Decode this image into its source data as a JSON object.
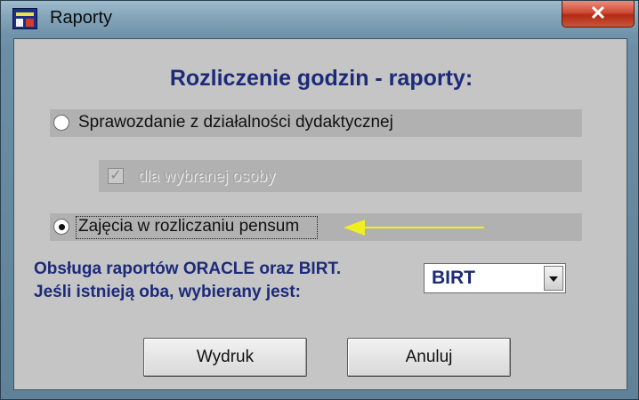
{
  "window": {
    "title": "Raporty",
    "close_glyph": "✕"
  },
  "heading": "Rozliczenie godzin - raporty:",
  "options": {
    "report1": {
      "label": "Sprawozdanie z działalności dydaktycznej",
      "selected": false
    },
    "person_checkbox": {
      "label": "dla wybranej osoby",
      "checked": true,
      "disabled": true
    },
    "report2": {
      "label": "Zajęcia w rozliczaniu pensum",
      "selected": true
    }
  },
  "info": {
    "line1": "Obsługa raportów ORACLE oraz BIRT.",
    "line2": "Jeśli  istnieją oba, wybierany jest:"
  },
  "engine_select": {
    "value": "BIRT"
  },
  "buttons": {
    "print": "Wydruk",
    "cancel": "Anuluj"
  },
  "annotation": {
    "arrow_color": "#f1ee22"
  },
  "icons": [
    "app-icon",
    "close-icon",
    "radio-icon",
    "checkbox-icon",
    "dropdown-arrow-icon",
    "annotation-arrow"
  ]
}
